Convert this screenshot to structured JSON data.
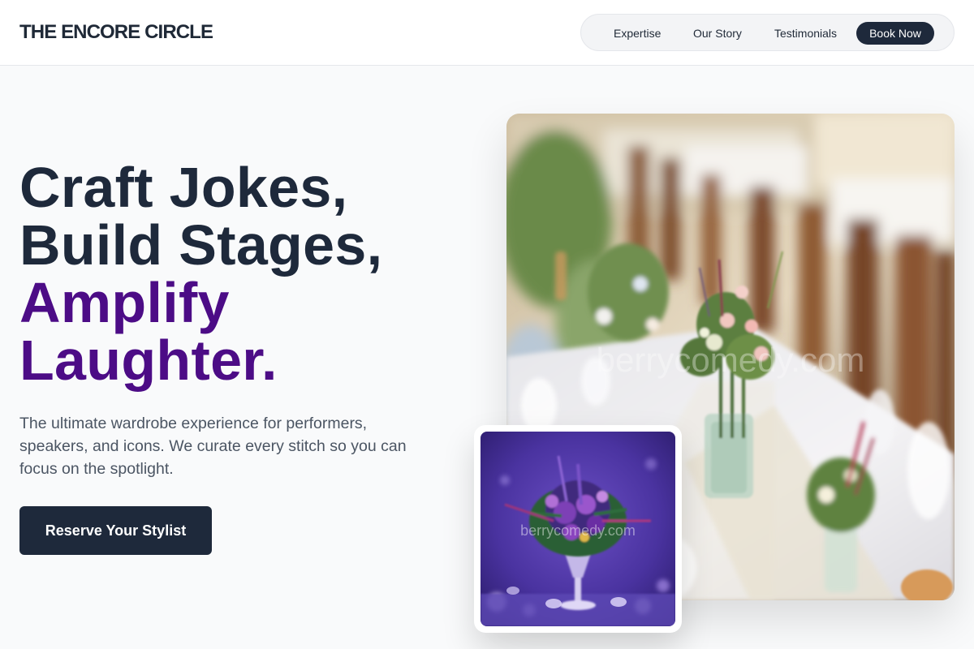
{
  "brand": {
    "name": "THE ENCORE CIRCLE"
  },
  "nav": {
    "items": [
      {
        "label": "Expertise"
      },
      {
        "label": "Our Story"
      },
      {
        "label": "Testimonials"
      }
    ],
    "cta_label": "Book Now"
  },
  "hero": {
    "title_lines": [
      "Craft Jokes,",
      "Build Stages,"
    ],
    "accent_lines": [
      "Amplify",
      "Laughter."
    ],
    "subtitle": "The ultimate wardrobe experience for performers, speakers, and icons. We curate every stitch so you can focus on the spotlight.",
    "cta_label": "Reserve Your Stylist"
  },
  "images": {
    "main_watermark": "berrycomedy.com",
    "inset_watermark": "berrycomedy.com"
  },
  "colors": {
    "primary": "#1e293b",
    "accent": "#4c0c86",
    "background": "#f9fafb"
  }
}
